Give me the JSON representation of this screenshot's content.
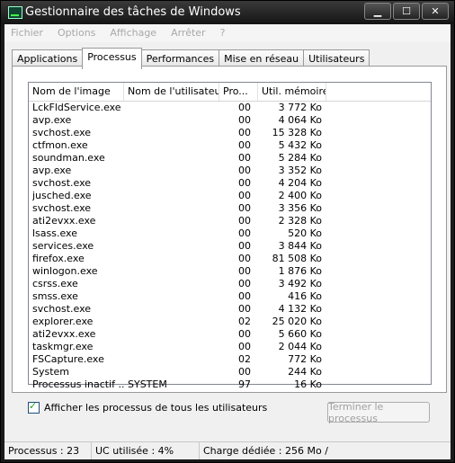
{
  "window": {
    "title": "Gestionnaire des tâches de Windows"
  },
  "menu": [
    "Fichier",
    "Options",
    "Affichage",
    "Arrêter",
    "?"
  ],
  "tabs": [
    {
      "label": "Applications"
    },
    {
      "label": "Processus"
    },
    {
      "label": "Performances"
    },
    {
      "label": "Mise en réseau"
    },
    {
      "label": "Utilisateurs"
    }
  ],
  "columns": [
    "Nom de l'image",
    "Nom de l'utilisateur",
    "Pro...",
    "Util. mémoire"
  ],
  "processes": [
    [
      "LckFldService.exe",
      "",
      "00",
      "3 772 Ko"
    ],
    [
      "avp.exe",
      "",
      "00",
      "4 064 Ko"
    ],
    [
      "svchost.exe",
      "",
      "00",
      "15 328 Ko"
    ],
    [
      "ctfmon.exe",
      "",
      "00",
      "5 432 Ko"
    ],
    [
      "soundman.exe",
      "",
      "00",
      "5 284 Ko"
    ],
    [
      "avp.exe",
      "",
      "00",
      "3 352 Ko"
    ],
    [
      "svchost.exe",
      "",
      "00",
      "4 204 Ko"
    ],
    [
      "jusched.exe",
      "",
      "00",
      "2 400 Ko"
    ],
    [
      "svchost.exe",
      "",
      "00",
      "3 356 Ko"
    ],
    [
      "ati2evxx.exe",
      "",
      "00",
      "2 328 Ko"
    ],
    [
      "lsass.exe",
      "",
      "00",
      "520 Ko"
    ],
    [
      "services.exe",
      "",
      "00",
      "3 844 Ko"
    ],
    [
      "firefox.exe",
      "",
      "00",
      "81 508 Ko"
    ],
    [
      "winlogon.exe",
      "",
      "00",
      "1 876 Ko"
    ],
    [
      "csrss.exe",
      "",
      "00",
      "3 492 Ko"
    ],
    [
      "smss.exe",
      "",
      "00",
      "416 Ko"
    ],
    [
      "svchost.exe",
      "",
      "00",
      "4 132 Ko"
    ],
    [
      "explorer.exe",
      "",
      "02",
      "25 020 Ko"
    ],
    [
      "ati2evxx.exe",
      "",
      "00",
      "5 660 Ko"
    ],
    [
      "taskmgr.exe",
      "",
      "00",
      "2 044 Ko"
    ],
    [
      "FSCapture.exe",
      "",
      "02",
      "772 Ko"
    ],
    [
      "System",
      "",
      "00",
      "244 Ko"
    ],
    [
      "Processus inactif ...",
      "SYSTEM",
      "97",
      "16 Ko"
    ]
  ],
  "show_all_label": "Afficher les processus de tous les utilisateurs",
  "end_process_label": "Terminer le processus",
  "status": {
    "processes": "Processus : 23",
    "cpu": "UC utilisée : 4%",
    "commit": "Charge dédiée : 256 Mo /"
  },
  "icons": {
    "minimize": "minimize-icon",
    "maximize": "maximize-icon",
    "close": "close-icon",
    "app": "task-manager-icon"
  }
}
